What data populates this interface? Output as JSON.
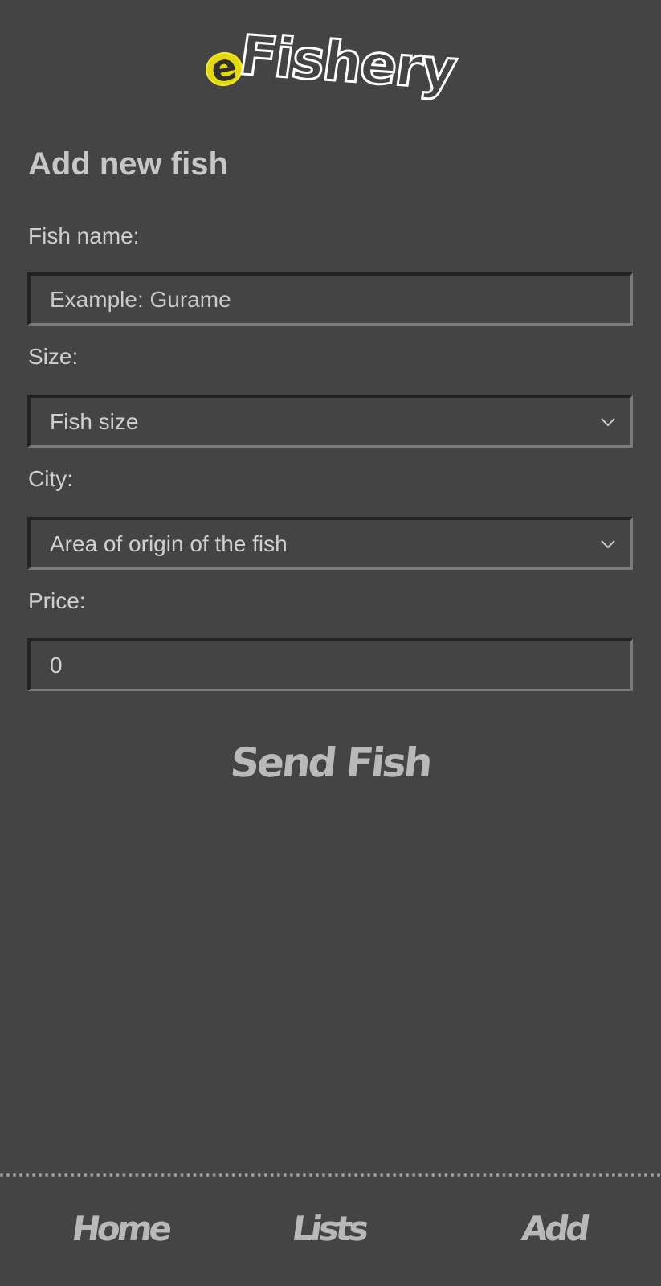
{
  "header": {
    "logo_prefix": "e",
    "logo_word": "Fishery"
  },
  "page": {
    "title": "Add new fish"
  },
  "form": {
    "fish_name": {
      "label": "Fish name:",
      "placeholder": "Example: Gurame"
    },
    "size": {
      "label": "Size:",
      "selected": "Fish size",
      "icon": "chevron-down-icon"
    },
    "city": {
      "label": "City:",
      "selected": "Area of origin of the fish",
      "icon": "chevron-down-icon"
    },
    "price": {
      "label": "Price:",
      "value": "0"
    },
    "submit_label": "Send Fish"
  },
  "bottom_nav": {
    "items": [
      {
        "label": "Home"
      },
      {
        "label": "Lists"
      },
      {
        "label": "Add"
      }
    ]
  },
  "colors": {
    "background": "#444444",
    "logo_accent": "#e3d80b",
    "text": "#d0d0d0"
  }
}
